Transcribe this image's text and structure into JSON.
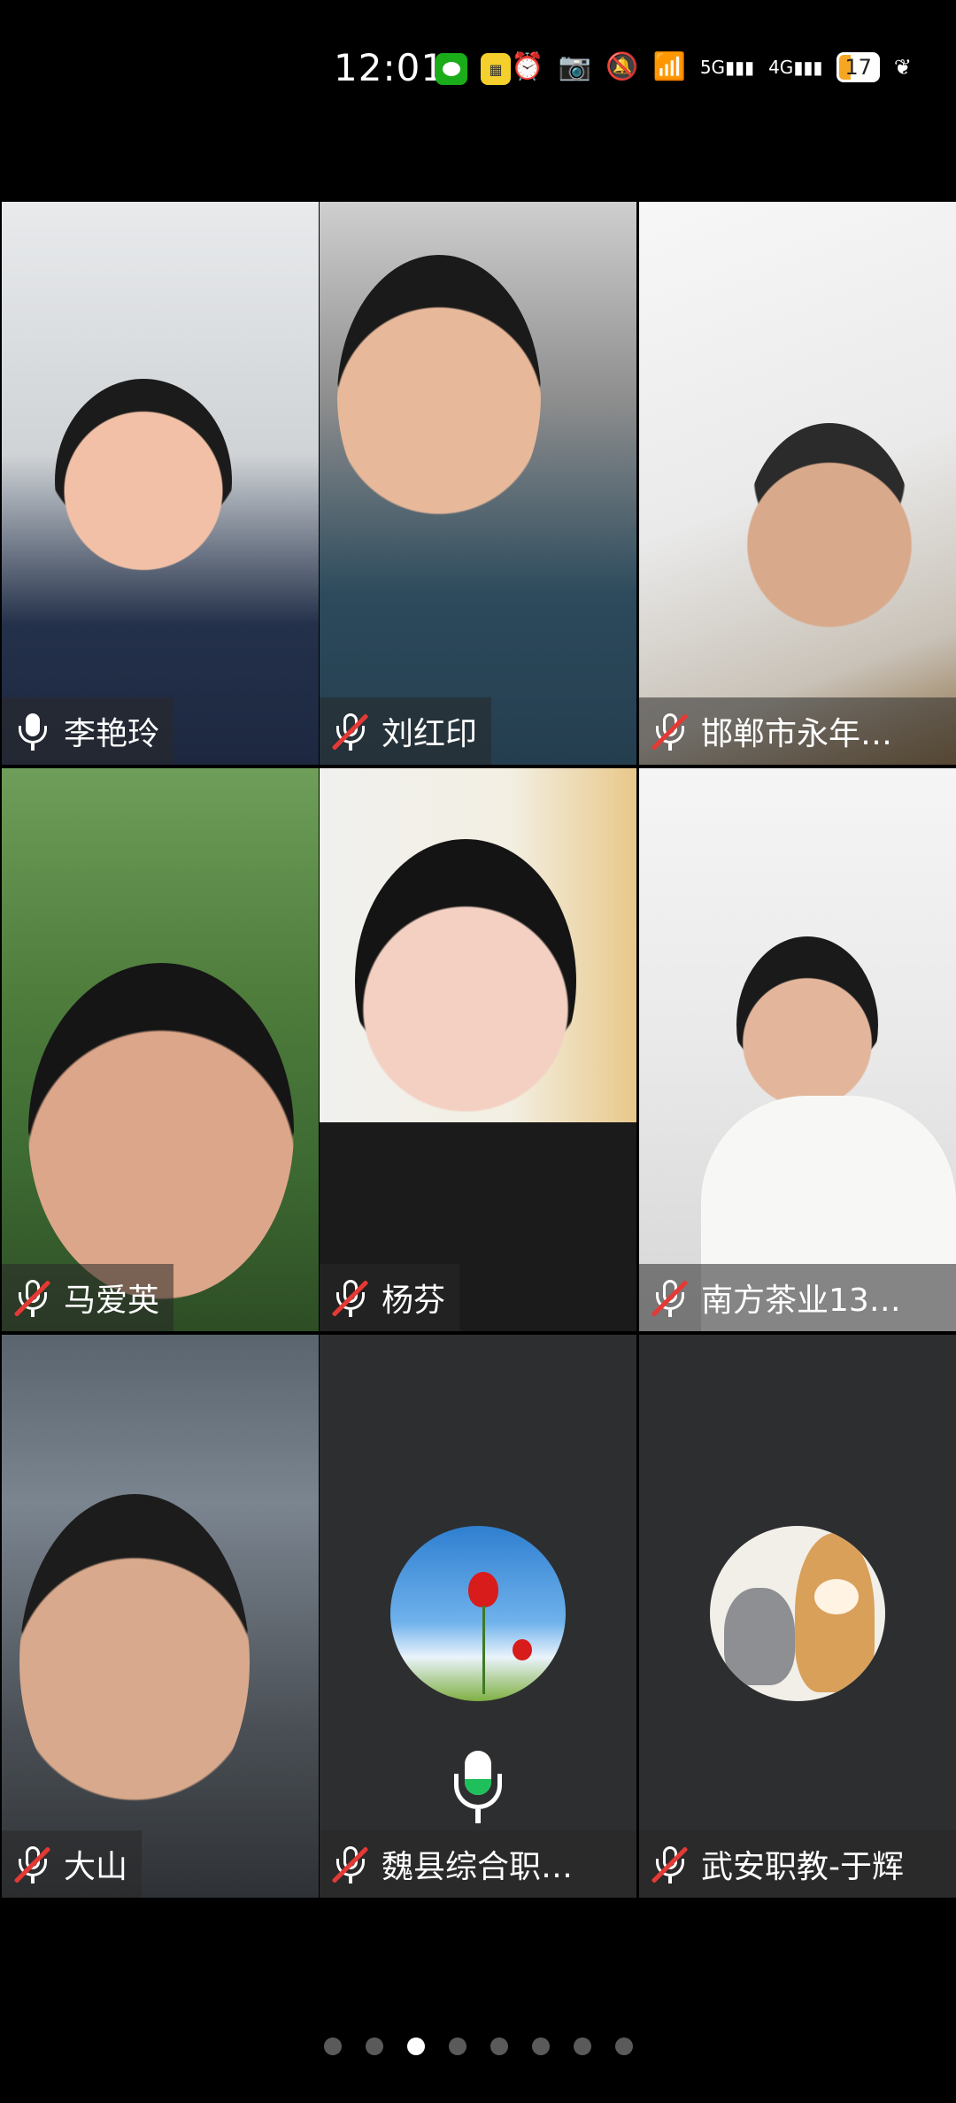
{
  "status_bar": {
    "time": "12:01",
    "app_icons": [
      "wechat-icon",
      "notification-app-icon"
    ],
    "right_icons": [
      "alarm-icon",
      "camera-icon",
      "mute-bell-icon",
      "wifi-icon",
      "5g-signal-icon",
      "4g-signal-icon"
    ],
    "network_5g": "5G",
    "network_4g": "4G",
    "battery": "17"
  },
  "participants": [
    {
      "name": "李艳玲",
      "mic": "on",
      "active": true
    },
    {
      "name": "刘红印",
      "mic": "muted"
    },
    {
      "name": "邯郸市永年…",
      "mic": "muted"
    },
    {
      "name": "马爱英",
      "mic": "muted"
    },
    {
      "name": "杨芬",
      "mic": "muted"
    },
    {
      "name": "南方茶业13…",
      "mic": "muted"
    },
    {
      "name": "大山",
      "mic": "muted"
    },
    {
      "name": "魏县综合职…",
      "mic": "muted",
      "avatar": "red-poppy-sky",
      "speaking_indicator": true
    },
    {
      "name": "武安职教-于辉",
      "mic": "muted",
      "avatar": "cat-and-shiba"
    }
  ],
  "pager": {
    "count": 8,
    "active_index": 2
  },
  "colors": {
    "active_border": "#1fbf5b",
    "muted_slash": "#e53935",
    "tile_bg": "#2d2e30"
  }
}
